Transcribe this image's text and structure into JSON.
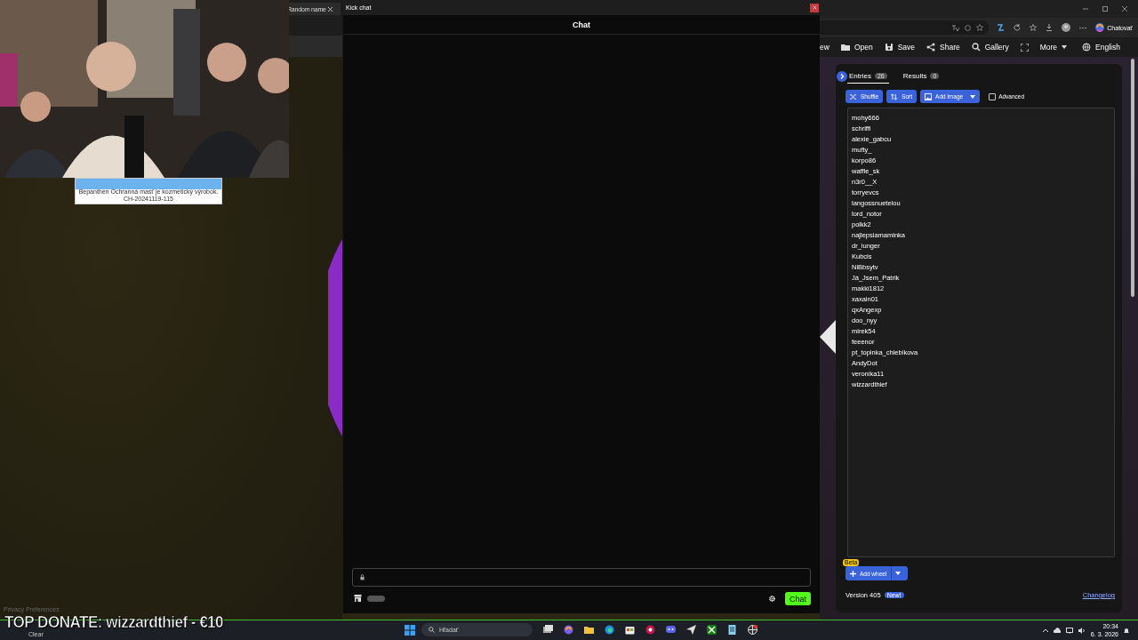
{
  "background_browser": {
    "tab_title": "Random name",
    "privacy_link": "Privacy Preferences"
  },
  "ad_banner": {
    "lines": [
      "Bepanthen Ochranná masť je kozmetický výrobok.",
      "CH-20241119-115"
    ]
  },
  "chat_window": {
    "title": "Kick chat",
    "header": "Chat",
    "send_button": "Chat"
  },
  "wheel_window": {
    "profile_button": "Chatovať",
    "menu": [
      "ew",
      "Open",
      "Save",
      "Share",
      "Gallery",
      "More",
      "English"
    ],
    "tabs": [
      {
        "label": "Entries",
        "count": "26",
        "selected": true
      },
      {
        "label": "Results",
        "count": "0",
        "selected": false
      }
    ],
    "tools": [
      "Shuffle",
      "Sort",
      "Add image"
    ],
    "advanced": {
      "label": "Advanced",
      "checked": false
    },
    "entries": [
      "mohy666",
      "schriffi",
      "alexie_gabcu",
      "mufty_",
      "korpo86",
      "waffle_sk",
      "n3r0__X",
      "torryevcs",
      "langossnuetelou",
      "lord_notor",
      "polkk2",
      "najlepsiamaminka",
      "dr_lunger",
      "Kubcis",
      "NiBbsytv",
      "Já_Jsem_Patrik",
      "makki1812",
      "xaxain01",
      "qxAngexp",
      "doo_nyy",
      "mirek54",
      "feeenor",
      "pt_topinka_chlebikova",
      "AndyDot",
      "veronika11",
      "wizzardthief"
    ],
    "add_wheel": {
      "label": "Add wheel",
      "badge": "Beta"
    },
    "version": "Version 405",
    "version_badge": "New!",
    "changelog": "Changelog"
  },
  "stream_overlay": {
    "top_donate": "TOP DONATE: wizzardthief - €10"
  },
  "taskbar": {
    "weather": "Clear",
    "search_placeholder": "Hľadať",
    "time": "20:34",
    "date": "6. 3. 2026"
  }
}
